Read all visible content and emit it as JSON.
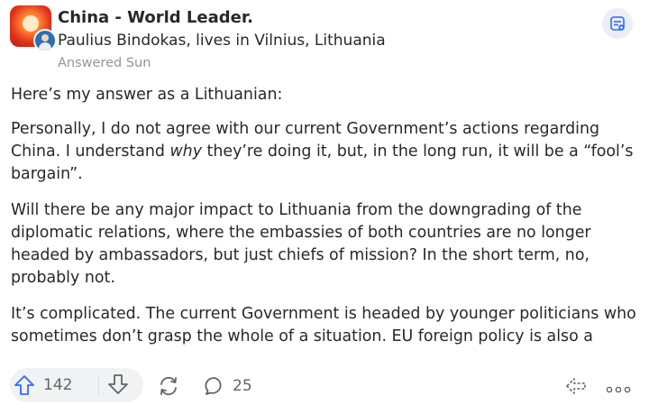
{
  "header": {
    "space_name": "China - World Leader.",
    "author_line": "Paulius Bindokas, lives in Vilnius, Lithuania",
    "answered": "Answered Sun"
  },
  "answer": {
    "p1": "Here’s my answer as a Lithuanian:",
    "p2_a": "Personally, I do not agree with our current Government’s actions regarding China. I understand ",
    "p2_em": "why",
    "p2_b": " they’re doing it, but, in the long run, it will be a “fool’s bargain”.",
    "p3": "Will there be any major impact to Lithuania from the downgrading of the diplomatic relations, where the embassies of both countries are no longer headed by ambassadors, but just chiefs of mission? In the short term, no, probably not.",
    "p4": "It’s complicated. The current Government is headed by younger politicians who sometimes don’t grasp the whole of a situation. EU foreign policy is also a"
  },
  "actions": {
    "upvotes": "142",
    "comments": "25"
  },
  "icons": {
    "space_logo": "sunset-icon",
    "share": "share-icon",
    "upvote": "arrow-up-icon",
    "downvote": "arrow-down-icon",
    "reshare": "reshare-icon",
    "comment": "comment-bubble-icon",
    "repost": "repost-icon",
    "more": "more-dots-icon"
  },
  "colors": {
    "accent": "#2e69ff",
    "text": "#282829",
    "muted": "#939598"
  }
}
